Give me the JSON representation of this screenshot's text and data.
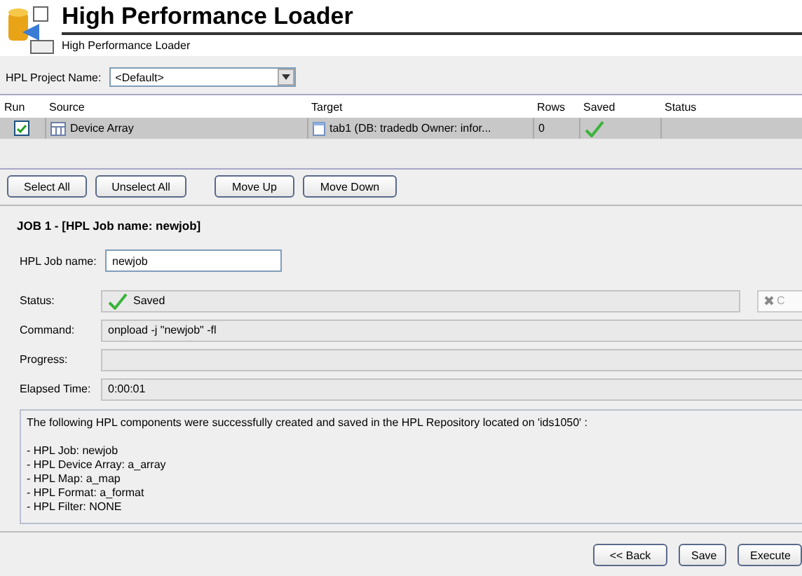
{
  "header": {
    "title": "High Performance Loader",
    "subtitle": "High Performance Loader"
  },
  "project": {
    "label": "HPL Project Name:",
    "value": "<Default>"
  },
  "table": {
    "columns": [
      "Run",
      "Source",
      "Target",
      "Rows",
      "Saved",
      "Status"
    ],
    "rows": [
      {
        "selected": true,
        "checked": true,
        "source": "Device Array",
        "target": "tab1 (DB: tradedb  Owner: infor...",
        "rows": "0",
        "saved": true
      }
    ]
  },
  "table_buttons": [
    "Select All",
    "Unselect All",
    "Move Up",
    "Move Down"
  ],
  "job": {
    "heading": "JOB 1 - [HPL Job name: newjob]",
    "name_label": "HPL Job name:",
    "name_value": "newjob",
    "fields": [
      {
        "kind": "status",
        "label": "Status:",
        "value": "Saved",
        "saved": true,
        "button": {
          "label": "C",
          "disabled": true
        }
      },
      {
        "kind": "text",
        "label": "Command:",
        "value": "onpload -j \"newjob\" -fl"
      },
      {
        "kind": "progress",
        "label": "Progress:",
        "level": 0
      },
      {
        "kind": "text",
        "label": "Elapsed Time:",
        "value": "0:00:01"
      }
    ],
    "message": {
      "text": "The following HPL components were successfully created and saved in the HPL Repository located on 'ids1050' :",
      "items": [
        "- HPL Job: newjob",
        "- HPL Device Array: a_array",
        "- HPL Map: a_map",
        "- HPL Format: a_format",
        "- HPL Filter: NONE"
      ]
    }
  },
  "footer_buttons": [
    "<< Back",
    "Save",
    "Execute"
  ]
}
